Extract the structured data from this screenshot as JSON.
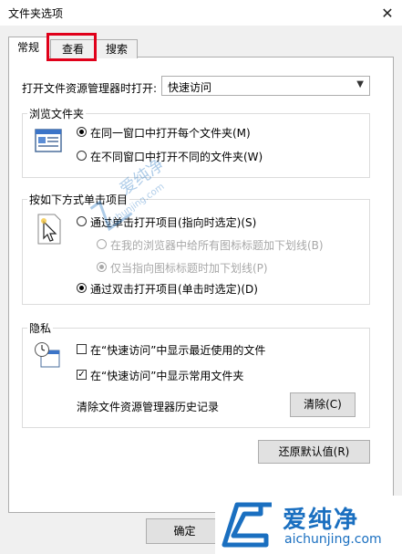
{
  "window": {
    "title": "文件夹选项",
    "close_icon": "close-icon"
  },
  "tabs": [
    {
      "label": "常规",
      "active": true
    },
    {
      "label": "查看",
      "active": false,
      "highlighted": true
    },
    {
      "label": "搜索",
      "active": false
    }
  ],
  "open_explorer": {
    "label": "打开文件资源管理器时打开:",
    "value": "快速访问"
  },
  "browse_folders": {
    "title": "浏览文件夹",
    "options": [
      {
        "label": "在同一窗口中打开每个文件夹(M)",
        "selected": true
      },
      {
        "label": "在不同窗口中打开不同的文件夹(W)",
        "selected": false
      }
    ]
  },
  "click_items": {
    "title": "按如下方式单击项目",
    "single_click": {
      "label": "通过单击打开项目(指向时选定)(S)",
      "selected": false
    },
    "sub_options": [
      {
        "label": "在我的浏览器中给所有图标标题加下划线(B)",
        "selected": false,
        "disabled": true
      },
      {
        "label": "仅当指向图标标题时加下划线(P)",
        "selected": true,
        "disabled": true
      }
    ],
    "double_click": {
      "label": "通过双击打开项目(单击时选定)(D)",
      "selected": true
    }
  },
  "privacy": {
    "title": "隐私",
    "checkboxes": [
      {
        "label": "在“快速访问”中显示最近使用的文件",
        "checked": false
      },
      {
        "label": "在“快速访问”中显示常用文件夹",
        "checked": true
      }
    ],
    "clear_label": "清除文件资源管理器历史记录",
    "clear_button": "清除(C)"
  },
  "restore_defaults": "还原默认值(R)",
  "footer": {
    "ok_button": "确定"
  },
  "watermark": {
    "brand": "爱纯净",
    "url": "aichunjing.com"
  },
  "colors": {
    "highlight": "#e0001a",
    "watermark_blue": "#1a6fc0"
  }
}
